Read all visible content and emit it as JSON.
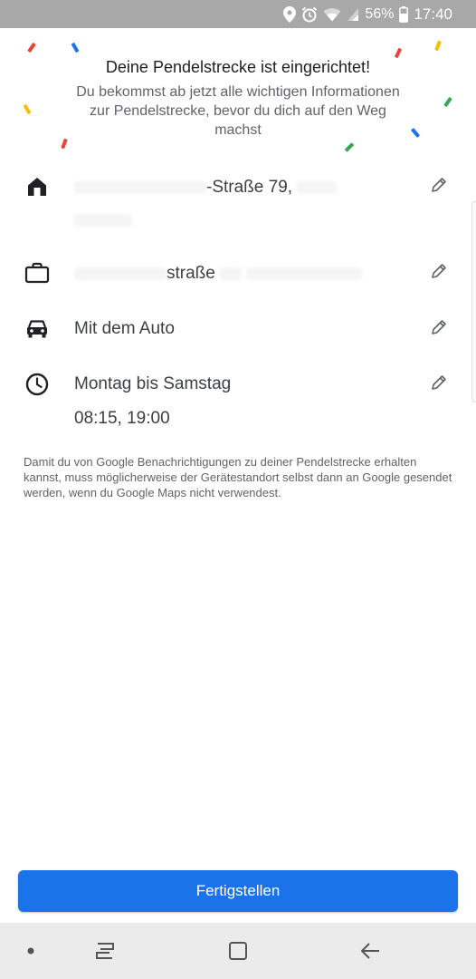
{
  "status_bar": {
    "battery": "56%",
    "time": "17:40",
    "icons": [
      "location-icon",
      "alarm-icon",
      "wifi-icon",
      "signal-icon",
      "battery-icon"
    ]
  },
  "header": {
    "title": "Deine Pendelstrecke ist eingerichtet!",
    "subtitle": "Du bekommst ab jetzt alle wichtigen Informationen zur Pendelstrecke, bevor du dich auf den Weg machst"
  },
  "rows": {
    "home": {
      "icon": "home-icon",
      "line1_visible": "-Straße 79,",
      "edit_icon": "pencil-icon"
    },
    "work": {
      "icon": "briefcase-icon",
      "line1_visible": "straße",
      "edit_icon": "pencil-icon"
    },
    "mode": {
      "icon": "car-icon",
      "label": "Mit dem Auto",
      "edit_icon": "pencil-icon"
    },
    "schedule": {
      "icon": "clock-icon",
      "days": "Montag bis Samstag",
      "times": "08:15, 19:00",
      "edit_icon": "pencil-icon"
    }
  },
  "disclaimer": "Damit du von Google Benachrichtigungen zu deiner Pendelstrecke erhalten kannst, muss möglicherweise der Gerätestandort selbst dann an Google gesendet werden, wenn du Google Maps nicht verwendest.",
  "done_button": {
    "label": "Fertigstellen"
  },
  "colors": {
    "accent": "#1a73e8",
    "confetti": [
      "#ea4335",
      "#1a73e8",
      "#fbbc04",
      "#34a853"
    ]
  },
  "nav_bar": {
    "icons": [
      "dot-icon",
      "recents-icon",
      "home-square-icon",
      "back-icon"
    ]
  }
}
